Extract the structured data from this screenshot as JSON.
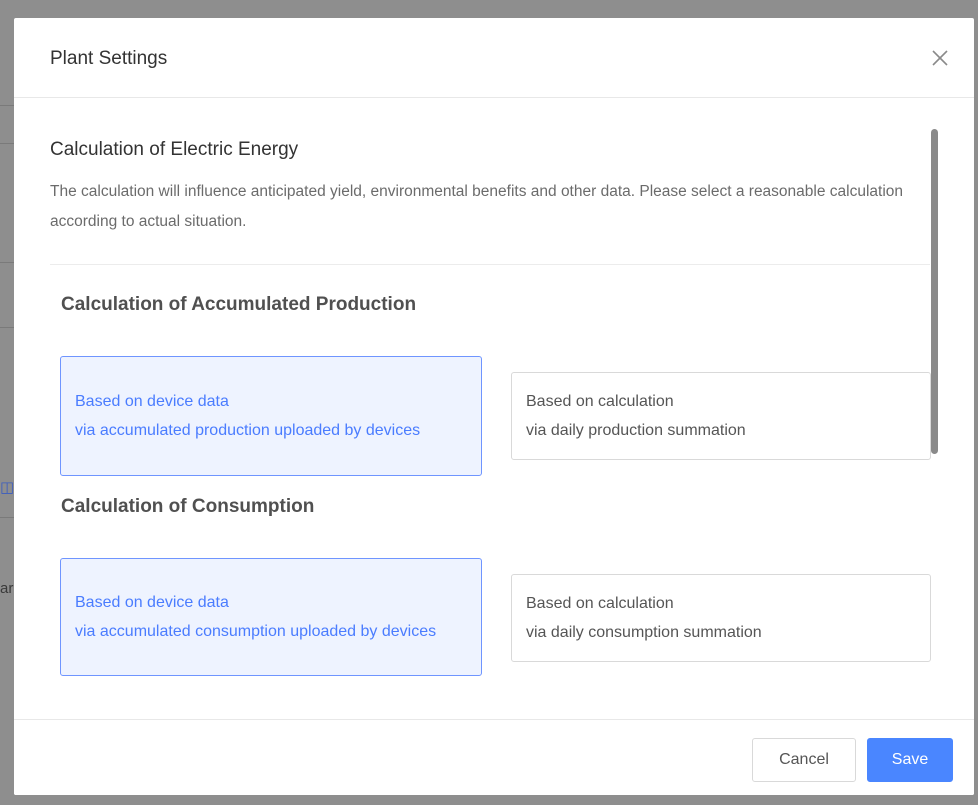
{
  "background": {
    "fragment_1": "",
    "fragment_2": "ar"
  },
  "modal": {
    "title": "Plant Settings",
    "close_icon": "close-icon"
  },
  "section": {
    "title": "Calculation of Electric Energy",
    "description": "The calculation will influence anticipated yield, environmental benefits and other data. Please select a reasonable calculation according to actual situation."
  },
  "accumulated_production": {
    "title": "Calculation of Accumulated Production",
    "options": [
      {
        "line1": "Based on device data",
        "line2": "via accumulated production uploaded by devices",
        "selected": true
      },
      {
        "line1": "Based on calculation",
        "line2": "via daily production summation",
        "selected": false
      }
    ]
  },
  "consumption": {
    "title": "Calculation of Consumption",
    "options": [
      {
        "line1": "Based on device data",
        "line2": "via accumulated consumption uploaded by devices",
        "selected": true
      },
      {
        "line1": "Based on calculation",
        "line2": "via daily consumption summation",
        "selected": false
      }
    ]
  },
  "footer": {
    "cancel_label": "Cancel",
    "save_label": "Save"
  },
  "colors": {
    "accent": "#4a86ff",
    "selected_bg": "#eef3ff",
    "selected_text": "#4a7cff"
  }
}
